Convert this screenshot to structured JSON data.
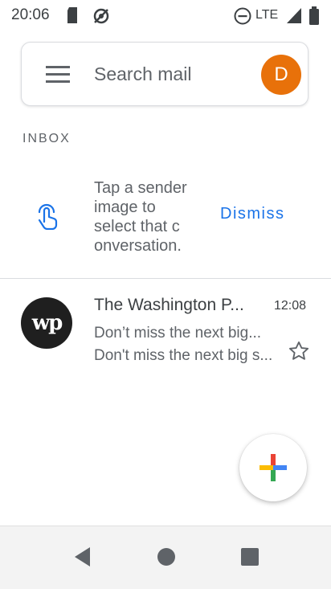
{
  "status_bar": {
    "time": "20:06",
    "icons": [
      "sd-card-icon",
      "sync-icon",
      "dnd-icon",
      "lte-icon",
      "signal-icon",
      "battery-icon"
    ],
    "network_label": "LTE"
  },
  "search": {
    "placeholder": "Search mail",
    "avatar_letter": "D",
    "avatar_color": "#e8710a"
  },
  "inbox": {
    "section_label": "INBOX",
    "tip": {
      "text": "Tap a sender image to select that c onversation.",
      "dismiss_label": "Dismiss"
    },
    "emails": [
      {
        "sender": "The Washington P...",
        "avatar_text": "wp",
        "time": "12:08",
        "subject": "Don’t miss the next big...",
        "snippet": "Don't miss the next big s...",
        "starred": false
      }
    ]
  },
  "colors": {
    "accent": "#1a73e8",
    "divider": "#dadce0"
  }
}
